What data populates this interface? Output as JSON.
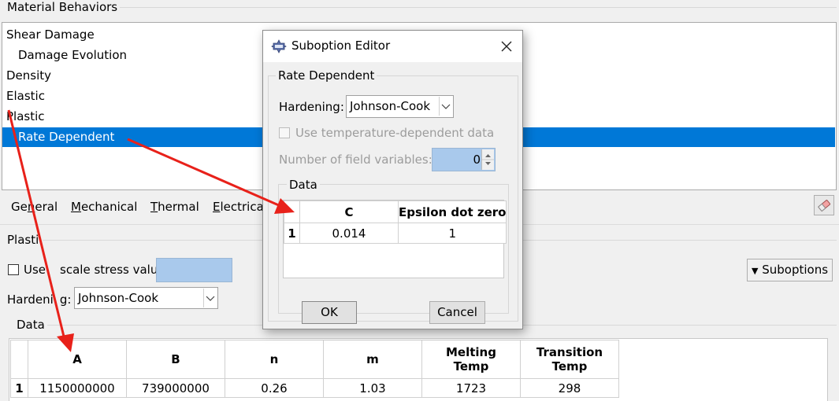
{
  "material_behaviors": {
    "title": "Material Behaviors",
    "items": [
      {
        "label": "Shear Damage",
        "indent": false,
        "selected": false
      },
      {
        "label": "Damage Evolution",
        "indent": true,
        "selected": false
      },
      {
        "label": "Density",
        "indent": false,
        "selected": false
      },
      {
        "label": "Elastic",
        "indent": false,
        "selected": false
      },
      {
        "label": "Plastic",
        "indent": false,
        "selected": false
      },
      {
        "label": "Rate Dependent",
        "indent": true,
        "selected": true
      }
    ]
  },
  "menu": {
    "general": {
      "before": "Ge",
      "mnemonic": "n",
      "after": "eral"
    },
    "mechanical": {
      "before": "",
      "mnemonic": "M",
      "after": "echanical"
    },
    "thermal": {
      "before": "",
      "mnemonic": "T",
      "after": "hermal"
    },
    "electrical": {
      "before": "",
      "mnemonic": "E",
      "after": "lectrical"
    },
    "eraser_icon": "eraser-icon"
  },
  "plastic": {
    "group_title": "Plasti",
    "use_scale_label": "Use",
    "use_scale_label_rest": "scale stress value:",
    "use_scale_checked": false,
    "hardening_label_a": "Hardeni",
    "hardening_label_b": "g:",
    "hardening_value": "Johnson-Cook",
    "suboptions_label": "Suboptions",
    "data_group_title": "Data",
    "table": {
      "columns": [
        "A",
        "B",
        "n",
        "m",
        "Melting\nTemp",
        "Transition\nTemp"
      ],
      "rows": [
        {
          "index": "1",
          "cells": [
            "1150000000",
            "739000000",
            "0.26",
            "1.03",
            "1723",
            "298"
          ]
        }
      ]
    }
  },
  "dialog": {
    "title": "Suboption Editor",
    "title_icon": "abaqus-editor-icon",
    "group_title": "Rate Dependent",
    "hardening_label": "Hardening:",
    "hardening_value": "Johnson-Cook",
    "temp_dependent_label": "Use temperature-dependent data",
    "temp_dependent_checked": false,
    "field_vars_label": "Number of field variables:",
    "field_vars_value": "0",
    "data_group_title": "Data",
    "table": {
      "columns": [
        "C",
        "Epsilon dot zero"
      ],
      "rows": [
        {
          "index": "1",
          "cells": [
            "0.014",
            "1"
          ]
        }
      ]
    },
    "ok_label": "OK",
    "cancel_label": "Cancel"
  },
  "colors": {
    "selection": "#0078d7",
    "annotation_arrow": "#e8211a",
    "disabled_field": "#a9c9ec"
  }
}
